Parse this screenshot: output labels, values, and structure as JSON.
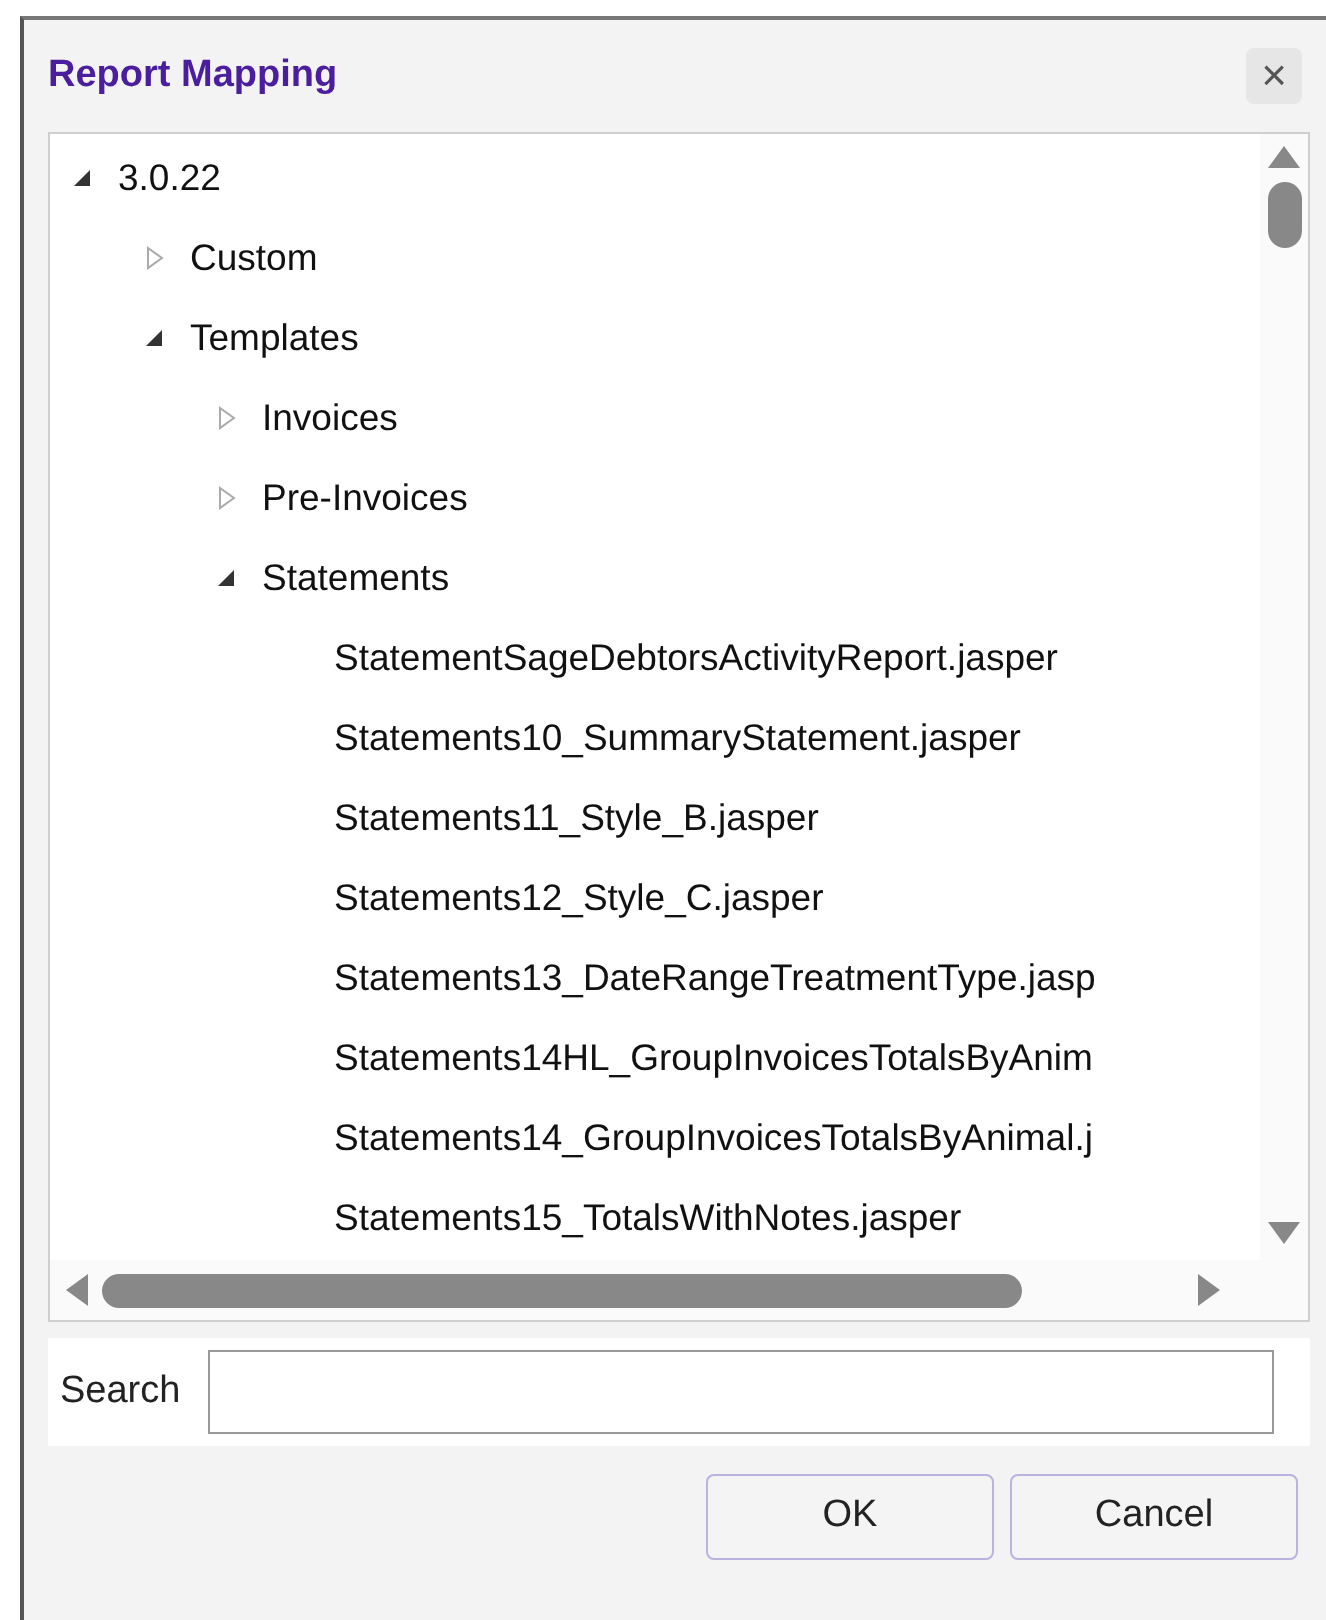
{
  "window": {
    "title": "Report Mapping",
    "close": "×"
  },
  "tree": [
    {
      "label": "3.0.22",
      "expanded": true,
      "children": [
        {
          "label": "Custom",
          "expanded": false
        },
        {
          "label": "Templates",
          "expanded": true,
          "children": [
            {
              "label": "Invoices",
              "expanded": false
            },
            {
              "label": "Pre-Invoices",
              "expanded": false
            },
            {
              "label": "Statements",
              "expanded": true,
              "children": [
                {
                  "label": "StatementSageDebtorsActivityReport.jasper"
                },
                {
                  "label": "Statements10_SummaryStatement.jasper"
                },
                {
                  "label": "Statements11_Style_B.jasper"
                },
                {
                  "label": "Statements12_Style_C.jasper"
                },
                {
                  "label": "Statements13_DateRangeTreatmentType.jasp"
                },
                {
                  "label": "Statements14HL_GroupInvoicesTotalsByAnim"
                },
                {
                  "label": "Statements14_GroupInvoicesTotalsByAnimal.j"
                },
                {
                  "label": "Statements15_TotalsWithNotes.jasper"
                }
              ]
            }
          ]
        }
      ]
    }
  ],
  "search": {
    "label": "Search"
  },
  "buttons": [
    "OK",
    "Cancel"
  ]
}
